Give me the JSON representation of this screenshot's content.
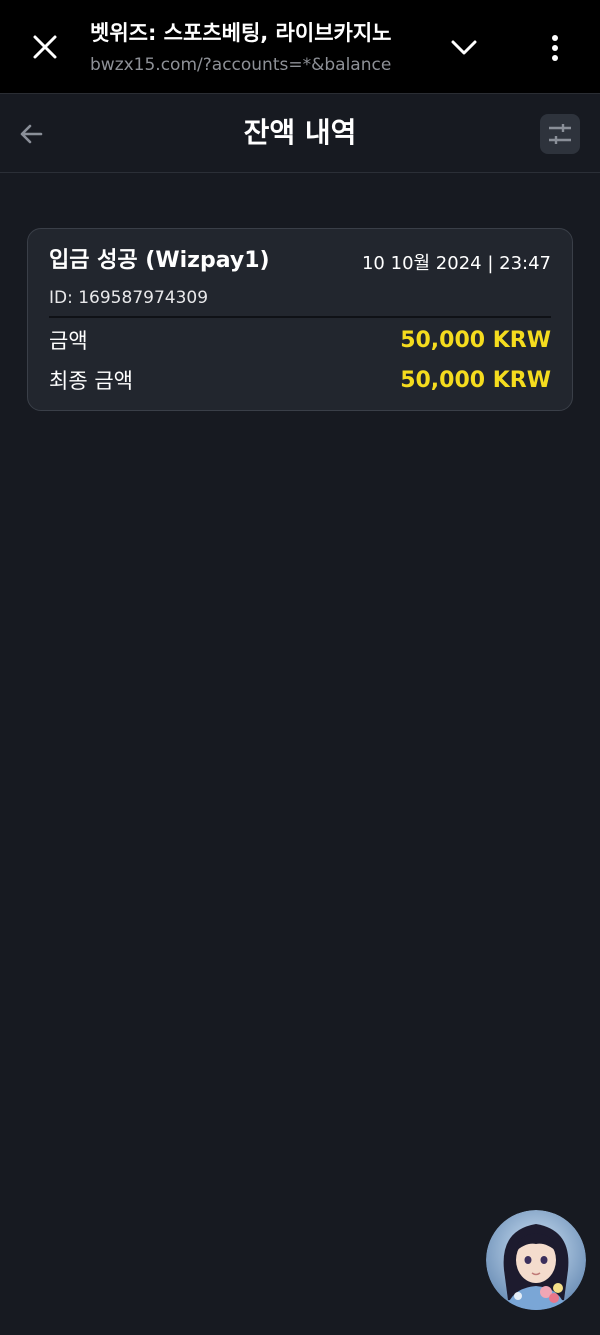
{
  "browser": {
    "page_title": "벳위즈: 스포츠베팅, 라이브카지노",
    "url": "bwzx15.com/?accounts=*&balance"
  },
  "header": {
    "title": "잔액 내역"
  },
  "transactions": [
    {
      "title": "입금 성공 (Wizpay1)",
      "date": "10 10월 2024 | 23:47",
      "id": "ID: 169587974309",
      "rows": [
        {
          "label": "금액",
          "value": "50,000 KRW"
        },
        {
          "label": "최종 금액",
          "value": "50,000 KRW"
        }
      ]
    }
  ],
  "colors": {
    "background": "#171a21",
    "card": "#22262e",
    "accent_amount": "#f5dc1e",
    "browser_bar": "#000000"
  },
  "icons": [
    "close-icon",
    "chevron-down-icon",
    "more-vertical-icon",
    "back-arrow-icon",
    "sliders-icon",
    "support-avatar"
  ]
}
